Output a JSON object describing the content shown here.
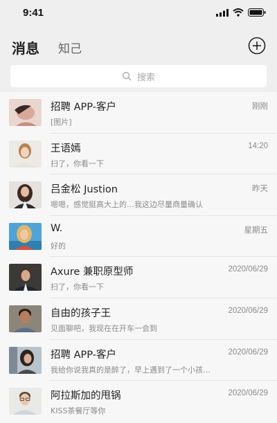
{
  "status_bar": {
    "time": "9:41"
  },
  "header": {
    "tab_active": "消息",
    "tab_inactive": "知己"
  },
  "search": {
    "placeholder": "搜索"
  },
  "messages": [
    {
      "name": "招聘 APP-客户",
      "preview": "[图片]",
      "time": "刚刚"
    },
    {
      "name": "王语嫣",
      "preview": "扫了，你看一下",
      "time": "14:20"
    },
    {
      "name": "吕金松 Justion",
      "preview": "嗯嗯，感觉挺高大上的…我这边尽量商量确认",
      "time": "昨天"
    },
    {
      "name": "W.",
      "preview": "好的",
      "time": "星期五"
    },
    {
      "name": "Axure  兼职原型师",
      "preview": "扫了，你看一下",
      "time": "2020/06/29"
    },
    {
      "name": "自由的孩子王",
      "preview": "见面聊吧，我现在在开车一会到",
      "time": "2020/06/29"
    },
    {
      "name": "招聘 APP-客户",
      "preview": "我给你说我真的是醉了，早上遇到了一个小孩…",
      "time": "2020/06/29"
    },
    {
      "name": "阿拉斯加的甩锅",
      "preview": "KISS茶餐厅等你",
      "time": "2020/06/29"
    }
  ]
}
